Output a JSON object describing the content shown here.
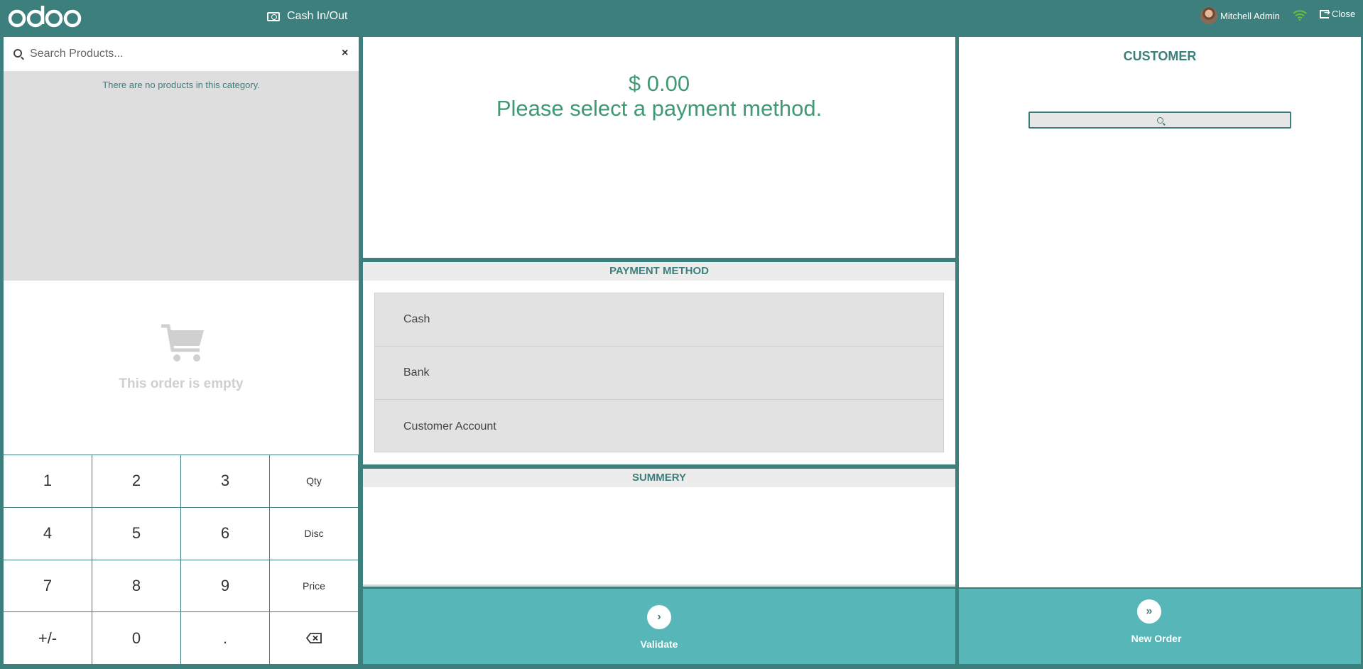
{
  "topbar": {
    "brand": "odoo",
    "cash_label": "Cash In/Out",
    "user_name": "Mitchell Admin",
    "close_label": "Close"
  },
  "products": {
    "search_placeholder": "Search Products...",
    "empty_message": "There are no products in this category."
  },
  "order": {
    "empty_text": "This order is empty"
  },
  "numpad": {
    "keys": [
      "1",
      "2",
      "3",
      "Qty",
      "4",
      "5",
      "6",
      "Disc",
      "7",
      "8",
      "9",
      "Price",
      "+/-",
      "0",
      "."
    ]
  },
  "payment": {
    "amount": "$ 0.00",
    "prompt": "Please select a payment method.",
    "method_header": "PAYMENT METHOD",
    "methods": [
      "Cash",
      "Bank",
      "Customer Account"
    ],
    "summary_header": "SUMMERY",
    "validate_label": "Validate"
  },
  "customer": {
    "header": "CUSTOMER",
    "new_order_label": "New Order"
  },
  "colors": {
    "topbar": "#3c7f7c",
    "action": "#57b6b7",
    "amount": "#3f9a72"
  }
}
